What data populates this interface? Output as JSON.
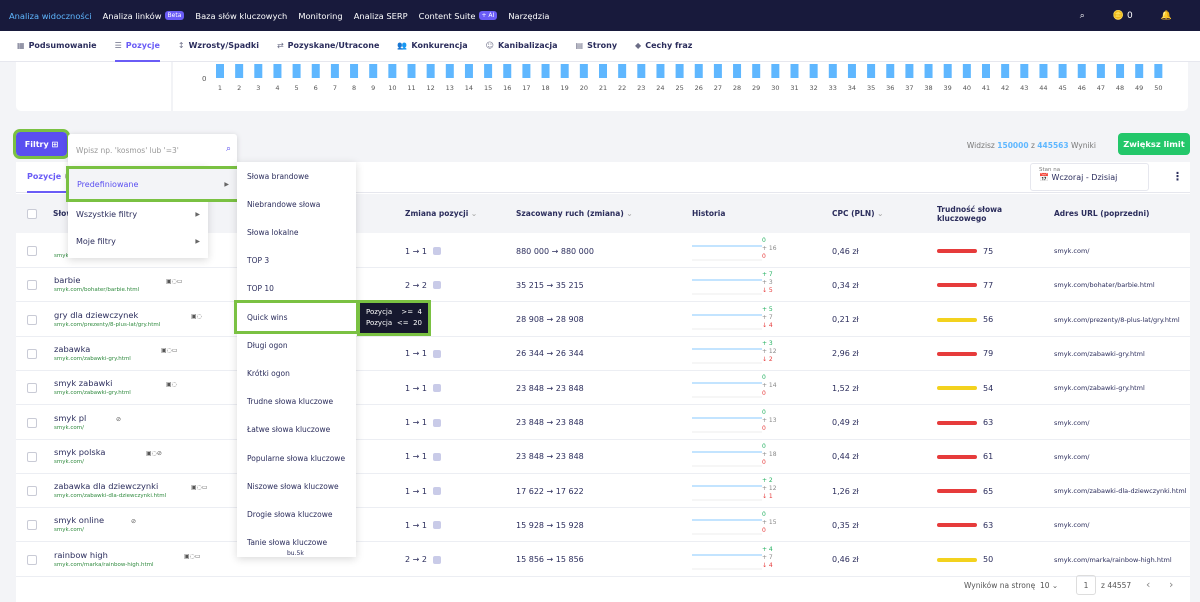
{
  "topnav": {
    "items": [
      {
        "label": "Analiza widoczności",
        "active": true
      },
      {
        "label": "Analiza linków",
        "badge": "Beta"
      },
      {
        "label": "Baza słów kluczowych"
      },
      {
        "label": "Monitoring"
      },
      {
        "label": "Analiza SERP"
      },
      {
        "label": "Content Suite",
        "badge": "+ AI"
      },
      {
        "label": "Narzędzia"
      }
    ],
    "coins": "0"
  },
  "subnav": {
    "items": [
      {
        "label": "Podsumowanie",
        "icon": "grid-icon"
      },
      {
        "label": "Pozycje",
        "icon": "list-icon",
        "active": true
      },
      {
        "label": "Wzrosty/Spadki",
        "icon": "trend-icon"
      },
      {
        "label": "Pozyskane/Utracone",
        "icon": "swap-icon"
      },
      {
        "label": "Konkurencja",
        "icon": "users-icon"
      },
      {
        "label": "Kanibalizacja",
        "icon": "person-icon"
      },
      {
        "label": "Strony",
        "icon": "pages-icon"
      },
      {
        "label": "Cechy fraz",
        "icon": "shapes-icon"
      }
    ]
  },
  "chart": {
    "y0": "0",
    "xticks": [
      "1",
      "2",
      "3",
      "4",
      "5",
      "6",
      "7",
      "8",
      "9",
      "10",
      "11",
      "12",
      "13",
      "14",
      "15",
      "16",
      "17",
      "18",
      "19",
      "20",
      "21",
      "22",
      "23",
      "24",
      "25",
      "26",
      "27",
      "28",
      "29",
      "30",
      "31",
      "32",
      "33",
      "34",
      "35",
      "36",
      "37",
      "38",
      "39",
      "40",
      "41",
      "42",
      "43",
      "44",
      "45",
      "46",
      "47",
      "48",
      "49",
      "50"
    ]
  },
  "chart_data": {
    "type": "bar",
    "categories": [
      "1",
      "2",
      "3",
      "4",
      "5",
      "6",
      "7",
      "8",
      "9",
      "10",
      "11",
      "12",
      "13",
      "14",
      "15",
      "16",
      "17",
      "18",
      "19",
      "20",
      "21",
      "22",
      "23",
      "24",
      "25",
      "26",
      "27",
      "28",
      "29",
      "30",
      "31",
      "32",
      "33",
      "34",
      "35",
      "36",
      "37",
      "38",
      "39",
      "40",
      "41",
      "42",
      "43",
      "44",
      "45",
      "46",
      "47",
      "48",
      "49",
      "50"
    ],
    "ylabel": "",
    "xlabel": "",
    "colors": [
      "#5fb7ff"
    ]
  },
  "filters": {
    "button": "Filtry",
    "search_placeholder": "Wpisz np. 'kosmos' lub '=3'",
    "visible_label": "Widzisz",
    "visible_count": "150000",
    "visible_of": "z",
    "visible_total": "445563",
    "visible_suffix": "Wyniki",
    "cta": "Zwiększ limit"
  },
  "table": {
    "tab": "Pozycje",
    "date_label": "Stan na",
    "date_value": "Wczoraj - Dzisiaj",
    "headers": {
      "keyword": "Słow",
      "pos_change": "Zmiana pozycji",
      "traffic": "Szacowany ruch (zmiana)",
      "history": "Historia",
      "cpc": "CPC (PLN)",
      "difficulty": "Trudność słowa kluczowego",
      "url": "Adres URL (poprzedni)"
    },
    "rows": [
      {
        "kw": "",
        "url": "smyk.com/",
        "pos": "1 → 1",
        "traffic": "880 000 → 880 000",
        "h": [
          "0",
          "+ 16",
          "0"
        ],
        "cpc": "0,46 zł",
        "diff": "75",
        "dcol": "#e63b3b",
        "adr": "smyk.com/"
      },
      {
        "kw": "barbie",
        "url": "smyk.com/bohater/barbie.html",
        "pos": "2 → 2",
        "traffic": "35 215 → 35 215",
        "h": [
          "+ 7",
          "+ 3",
          "↓ 5"
        ],
        "cpc": "0,34 zł",
        "diff": "77",
        "dcol": "#e63b3b",
        "adr": "smyk.com/bohater/barbie.html"
      },
      {
        "kw": "gry dla dziewczynek",
        "url": "smyk.com/prezenty/8-plus-lat/gry.html",
        "pos": "",
        "traffic": "28 908 → 28 908",
        "h": [
          "+ 5",
          "+ 7",
          "↓ 4"
        ],
        "cpc": "0,21 zł",
        "diff": "56",
        "dcol": "#f3d21e",
        "adr": "smyk.com/prezenty/8-plus-lat/gry.html"
      },
      {
        "kw": "zabawka",
        "url": "smyk.com/zabawki-gry.html",
        "pos": "1 → 1",
        "traffic": "26 344 → 26 344",
        "h": [
          "+ 3",
          "+ 12",
          "↓ 2"
        ],
        "cpc": "2,96 zł",
        "diff": "79",
        "dcol": "#e63b3b",
        "adr": "smyk.com/zabawki-gry.html"
      },
      {
        "kw": "smyk zabawki",
        "url": "smyk.com/zabawki-gry.html",
        "pos": "1 → 1",
        "traffic": "23 848 → 23 848",
        "h": [
          "0",
          "+ 14",
          "0"
        ],
        "cpc": "1,52 zł",
        "diff": "54",
        "dcol": "#f3d21e",
        "adr": "smyk.com/zabawki-gry.html"
      },
      {
        "kw": "smyk pl",
        "url": "smyk.com/",
        "pos": "1 → 1",
        "traffic": "23 848 → 23 848",
        "h": [
          "0",
          "+ 13",
          "0"
        ],
        "cpc": "0,49 zł",
        "diff": "63",
        "dcol": "#e63b3b",
        "adr": "smyk.com/"
      },
      {
        "kw": "smyk polska",
        "url": "smyk.com/",
        "pos": "1 → 1",
        "traffic": "23 848 → 23 848",
        "h": [
          "0",
          "+ 18",
          "0"
        ],
        "cpc": "0,44 zł",
        "diff": "61",
        "dcol": "#e63b3b",
        "adr": "smyk.com/"
      },
      {
        "kw": "zabawka dla dziewczynki",
        "url": "smyk.com/zabawki-dla-dziewczynki.html",
        "pos": "1 → 1",
        "traffic": "17 622 → 17 622",
        "h": [
          "+ 2",
          "+ 12",
          "↓ 1"
        ],
        "cpc": "1,26 zł",
        "diff": "65",
        "dcol": "#e63b3b",
        "adr": "smyk.com/zabawki-dla-dziewczynki.html"
      },
      {
        "kw": "smyk online",
        "url": "smyk.com/",
        "pos": "1 → 1",
        "traffic": "15 928 → 15 928",
        "h": [
          "0",
          "+ 15",
          "0"
        ],
        "cpc": "0,35 zł",
        "diff": "63",
        "dcol": "#e63b3b",
        "adr": "smyk.com/"
      },
      {
        "kw": "rainbow high",
        "url": "smyk.com/marka/rainbow-high.html",
        "pos": "2 → 2",
        "traffic": "15 856 → 15 856",
        "h": [
          "+ 4",
          "+ 7",
          "↓ 4"
        ],
        "cpc": "0,46 zł",
        "diff": "50",
        "dcol": "#f3d21e",
        "adr": "smyk.com/marka/rainbow-high.html"
      }
    ],
    "pag": {
      "per_page": "Wyników na stronę",
      "per_value": "10",
      "page": "1",
      "total": "z 44557"
    }
  },
  "menu1": [
    {
      "label": "Predefiniowane"
    },
    {
      "label": "Wszystkie filtry"
    },
    {
      "label": "Moje filtry"
    }
  ],
  "menu2": [
    "Słowa brandowe",
    "Niebrandowe słowa",
    "Słowa lokalne",
    "TOP 3",
    "TOP 10",
    "Quick wins",
    "Długi ogon",
    "Krótki ogon",
    "Trudne słowa kluczowe",
    "Łatwe słowa kluczowe",
    "Popularne słowa kluczowe",
    "Niszowe słowa kluczowe",
    "Drogie słowa kluczowe",
    "Tanie słowa kluczowe"
  ],
  "tooltip": {
    "l1": "Pozycja",
    "op1": ">=",
    "v1": "4",
    "l2": "Pozycja",
    "op2": "<=",
    "v2": "20"
  },
  "misc": {
    "partial_text": "bu.5k"
  }
}
